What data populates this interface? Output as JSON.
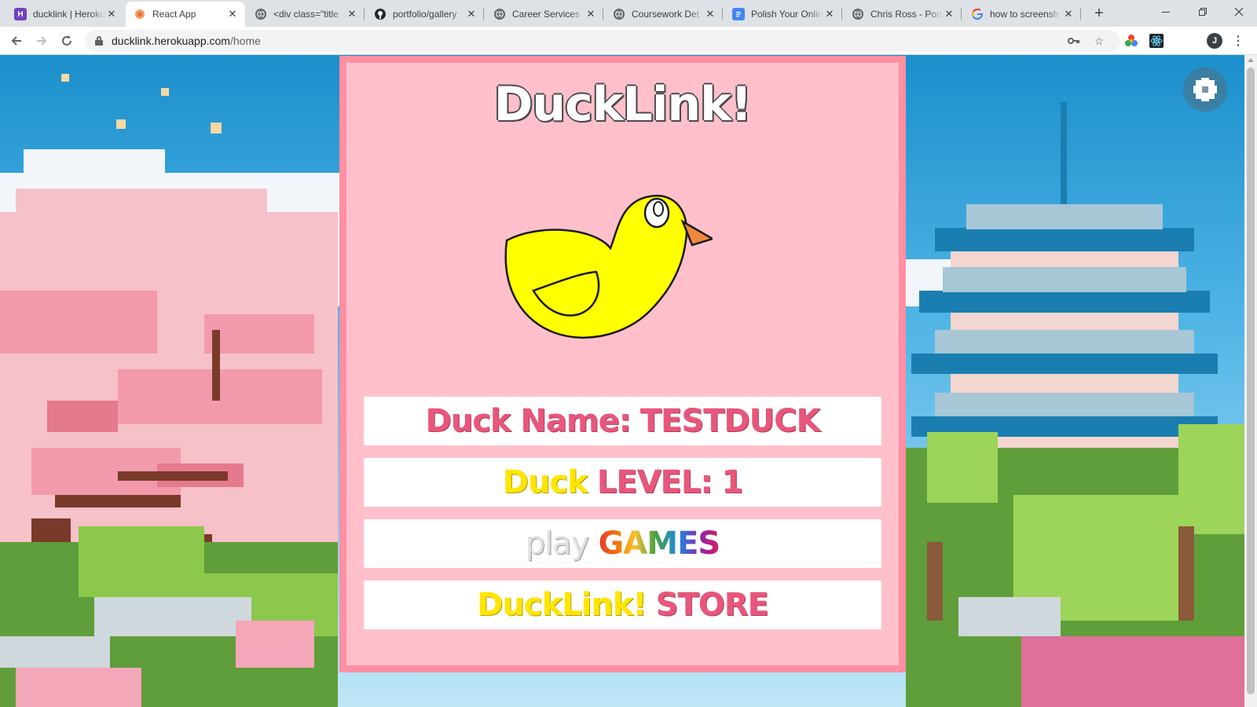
{
  "browser": {
    "tabs": [
      {
        "title": "ducklink | Heroku",
        "favicon": "heroku-icon",
        "active": false
      },
      {
        "title": "React App",
        "favicon": "react-icon",
        "active": true
      },
      {
        "title": "<div class=\"title",
        "favicon": "globe-icon",
        "active": false
      },
      {
        "title": "portfolio/gallery",
        "favicon": "github-icon",
        "active": false
      },
      {
        "title": "Career Services",
        "favicon": "globe-icon",
        "active": false
      },
      {
        "title": "Coursework Det",
        "favicon": "globe-icon",
        "active": false
      },
      {
        "title": "Polish Your Onlin",
        "favicon": "docs-icon",
        "active": false
      },
      {
        "title": "Chris Ross - Port",
        "favicon": "globe-icon",
        "active": false
      },
      {
        "title": "how to screensh",
        "favicon": "google-icon",
        "active": false
      }
    ],
    "new_tab": "+",
    "url_host": "ducklink.herokuapp.com",
    "url_path": "/home",
    "profile_initial": "J",
    "colors": {
      "chrome_bg": "#dee1e6",
      "toolbar_bg": "#ffffff"
    }
  },
  "page": {
    "title": "DuckLink!",
    "duck_image": "yellow-duck-illustration",
    "settings_icon": "gear-icon",
    "name_row": {
      "label": "Duck Name:",
      "value": "TESTDUCK"
    },
    "level_row": {
      "label_word": "Duck",
      "label_rest": "LEVEL:",
      "value": "1"
    },
    "games_button": {
      "prefix": "play",
      "label": "GAMES"
    },
    "store_button": {
      "brand": "DuckLink!",
      "label": "STORE"
    },
    "colors": {
      "card_bg": "#ffc0cb",
      "card_border": "#ff8fa3",
      "text_pink": "#e8577b",
      "text_yellow": "#ffe600",
      "duck_body": "#ffff00",
      "duck_beak": "#f0883b"
    }
  }
}
